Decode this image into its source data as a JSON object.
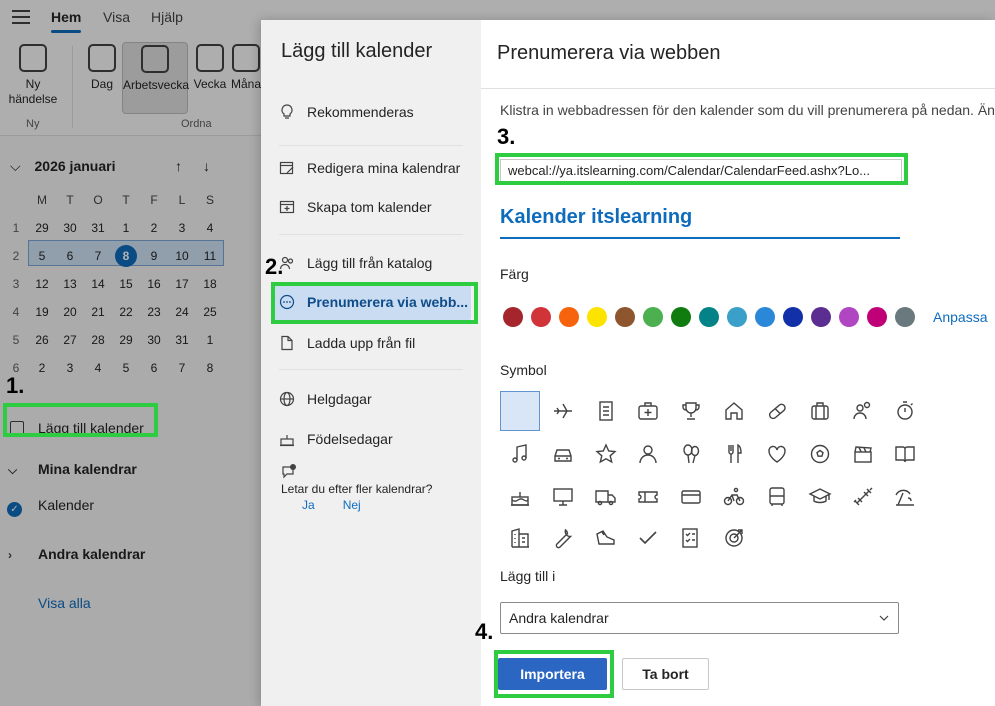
{
  "topbar": {
    "tabs": [
      "Hem",
      "Visa",
      "Hjälp"
    ],
    "active_tab": "Hem"
  },
  "ribbon": {
    "new_event": "Ny händelse",
    "group_new": "Ny",
    "day": "Dag",
    "work_week": "Arbetsvecka",
    "week": "Vecka",
    "month": "Måna",
    "group_arrange": "Ordna"
  },
  "mini_calendar": {
    "month_label": "2026 januari",
    "weekday_headers": [
      "M",
      "T",
      "O",
      "T",
      "F",
      "L",
      "S"
    ],
    "weeks": [
      {
        "week": "1",
        "days": [
          "29",
          "30",
          "31",
          "1",
          "2",
          "3",
          "4"
        ]
      },
      {
        "week": "2",
        "days": [
          "5",
          "6",
          "7",
          "8",
          "9",
          "10",
          "11"
        ]
      },
      {
        "week": "3",
        "days": [
          "12",
          "13",
          "14",
          "15",
          "16",
          "17",
          "18"
        ]
      },
      {
        "week": "4",
        "days": [
          "19",
          "20",
          "21",
          "22",
          "23",
          "24",
          "25"
        ]
      },
      {
        "week": "5",
        "days": [
          "26",
          "27",
          "28",
          "29",
          "30",
          "31",
          "1"
        ]
      },
      {
        "week": "6",
        "days": [
          "2",
          "3",
          "4",
          "5",
          "6",
          "7",
          "8"
        ]
      }
    ],
    "today": "8"
  },
  "left_panel": {
    "add_calendar": "Lägg till kalender",
    "my_calendars": "Mina kalendrar",
    "calendar_item": "Kalender",
    "other_calendars": "Andra kalendrar",
    "show_all": "Visa alla"
  },
  "dialog_nav": {
    "title": "Lägg till kalender",
    "recommended": "Rekommenderas",
    "edit_calendars": "Redigera mina kalendrar",
    "create_blank": "Skapa tom kalender",
    "add_from_directory": "Lägg till från katalog",
    "subscribe_web": "Prenumerera via webb...",
    "upload_file": "Ladda upp från fil",
    "holidays": "Helgdagar",
    "birthdays": "Födelsedagar",
    "more_question": "Letar du efter fler kalendrar?",
    "yes": "Ja",
    "no": "Nej"
  },
  "dialog_main": {
    "title": "Prenumerera via webben",
    "description": "Klistra in webbadressen för den kalender som du vill prenumerera på nedan. Änd",
    "url": "webcal://ya.itslearning.com/Calendar/CalendarFeed.ashx?Lo...",
    "calendar_name": "Kalender itslearning",
    "color_label": "Färg",
    "customize": "Anpassa",
    "symbol_label": "Symbol",
    "add_to_label": "Lägg till i",
    "add_to_value": "Andra kalendrar",
    "import_button": "Importera",
    "remove_button": "Ta bort"
  },
  "colors": [
    "#a4262c",
    "#d13438",
    "#f7630c",
    "#fde300",
    "#8e562e",
    "#4caf50",
    "#107c10",
    "#038387",
    "#3aa0c9",
    "#2b88d8",
    "#1231a8",
    "#5c2e91",
    "#b146c2",
    "#bf0077",
    "#69797e"
  ],
  "symbols": [
    "blank-icon",
    "airplane-icon",
    "document-icon",
    "medical-bag-icon",
    "trophy-icon",
    "home-icon",
    "pill-icon",
    "briefcase-icon",
    "people-icon",
    "stopwatch-icon",
    "music-note-icon",
    "car-icon",
    "star-icon",
    "person-icon",
    "balloons-icon",
    "cutlery-icon",
    "heart-icon",
    "soccer-ball-icon",
    "clapperboard-icon",
    "book-icon",
    "cake-icon",
    "monitor-icon",
    "truck-icon",
    "ticket-icon",
    "payment-card-icon",
    "bicycle-icon",
    "bus-icon",
    "graduation-cap-icon",
    "dumbbell-icon",
    "beach-icon",
    "building-icon",
    "wrench-icon",
    "running-shoe-icon",
    "checkmark-icon",
    "checklist-icon",
    "target-icon"
  ],
  "annotations": {
    "step1": "1.",
    "step2": "2.",
    "step3": "3.",
    "step4": "4."
  }
}
